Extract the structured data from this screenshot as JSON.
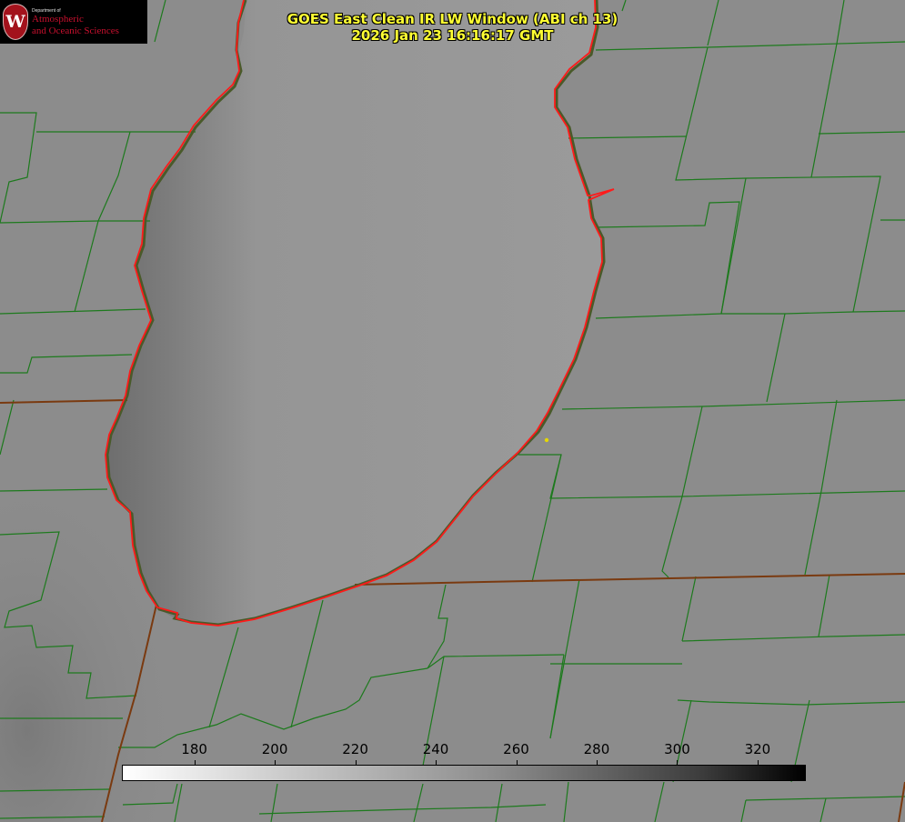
{
  "logo": {
    "department": "Department of",
    "line1": "Atmospheric",
    "line2": "and Oceanic Sciences",
    "seal_letter": "W"
  },
  "title": {
    "line1": "GOES East Clean IR LW Window (ABI ch 13)",
    "line2": "2026 Jan 23 16:16:17 GMT"
  },
  "colorbar": {
    "ticks": [
      "180",
      "200",
      "220",
      "240",
      "260",
      "280",
      "300",
      "320"
    ],
    "range": [
      162,
      332
    ]
  },
  "colors": {
    "land": "#8a8a8a",
    "lake": "#999999",
    "county_lines": "#1d7a1d",
    "state_lines": "#7a3a10",
    "coastline": "#ff1a1a",
    "title": "#ffff33"
  }
}
